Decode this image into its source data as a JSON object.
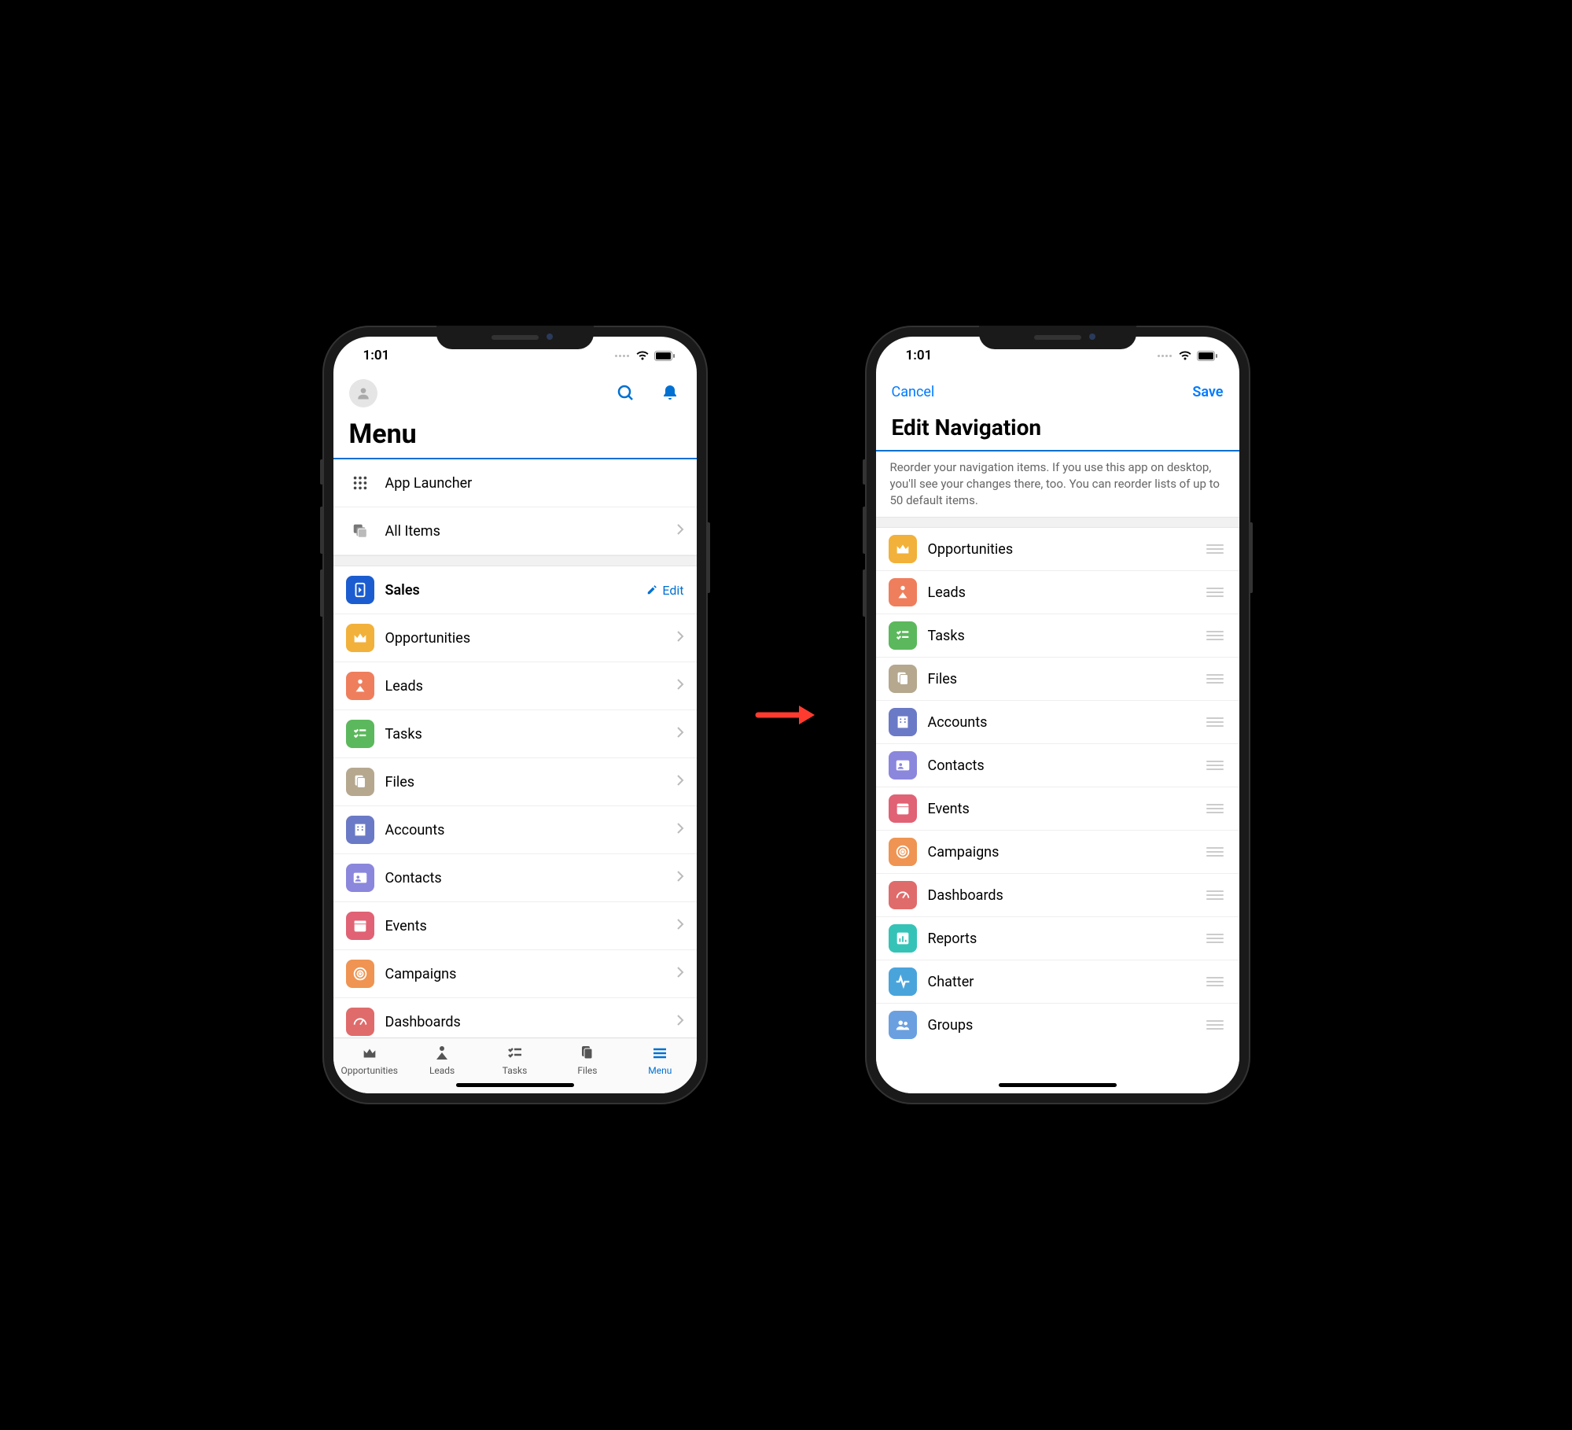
{
  "status": {
    "time": "1:01"
  },
  "left": {
    "page_title": "Menu",
    "app_launcher": "App Launcher",
    "all_items": "All Items",
    "sales_label": "Sales",
    "edit_label": "Edit",
    "items": [
      {
        "label": "Opportunities"
      },
      {
        "label": "Leads"
      },
      {
        "label": "Tasks"
      },
      {
        "label": "Files"
      },
      {
        "label": "Accounts"
      },
      {
        "label": "Contacts"
      },
      {
        "label": "Events"
      },
      {
        "label": "Campaigns"
      },
      {
        "label": "Dashboards"
      }
    ],
    "tabs": [
      {
        "label": "Opportunities"
      },
      {
        "label": "Leads"
      },
      {
        "label": "Tasks"
      },
      {
        "label": "Files"
      },
      {
        "label": "Menu"
      }
    ]
  },
  "right": {
    "cancel": "Cancel",
    "save": "Save",
    "title": "Edit Navigation",
    "help": "Reorder your navigation items. If you use this app on desktop, you'll see your changes there, too. You can reorder lists of up to 50 default items.",
    "items": [
      {
        "label": "Opportunities"
      },
      {
        "label": "Leads"
      },
      {
        "label": "Tasks"
      },
      {
        "label": "Files"
      },
      {
        "label": "Accounts"
      },
      {
        "label": "Contacts"
      },
      {
        "label": "Events"
      },
      {
        "label": "Campaigns"
      },
      {
        "label": "Dashboards"
      },
      {
        "label": "Reports"
      },
      {
        "label": "Chatter"
      },
      {
        "label": "Groups"
      }
    ]
  }
}
